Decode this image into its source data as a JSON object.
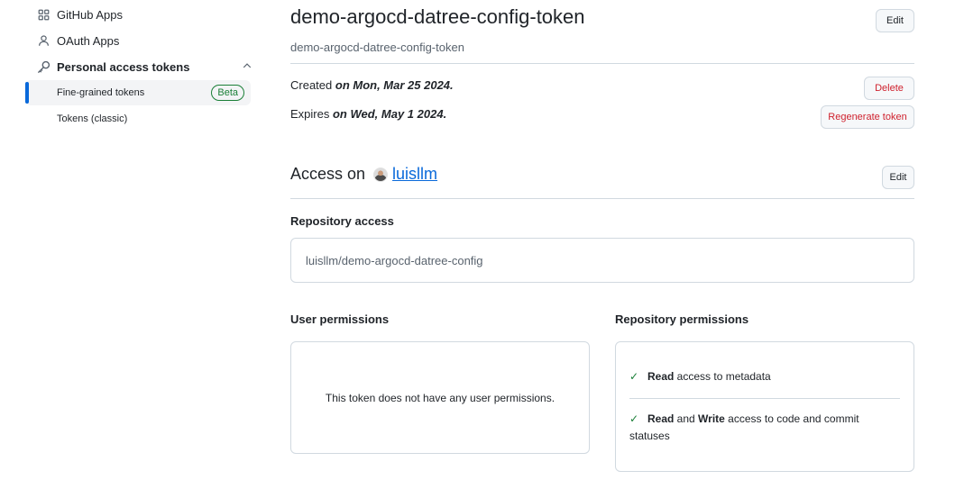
{
  "sidebar": {
    "github_apps": "GitHub Apps",
    "oauth_apps": "OAuth Apps",
    "personal_access_tokens": "Personal access tokens",
    "fine_grained": "Fine-grained tokens",
    "beta": "Beta",
    "classic": "Tokens (classic)"
  },
  "token": {
    "title": "demo-argocd-datree-config-token",
    "description": "demo-argocd-datree-config-token",
    "edit_label": "Edit",
    "created_prefix": "Created",
    "created_date": "on Mon, Mar 25 2024.",
    "expires_prefix": "Expires",
    "expires_date": "on Wed, May 1 2024.",
    "delete_label": "Delete",
    "regenerate_label": "Regenerate token"
  },
  "access": {
    "heading": "Access on",
    "user": "luisllm",
    "edit_label": "Edit",
    "repository_access_label": "Repository access",
    "repository": "luisllm/demo-argocd-datree-config",
    "user_permissions_label": "User permissions",
    "user_permissions_empty": "This token does not have any user permissions.",
    "repository_permissions_label": "Repository permissions",
    "permissions": [
      {
        "bold1": "Read",
        "text1": " access to metadata"
      },
      {
        "bold1": "Read",
        "mid": " and ",
        "bold2": "Write",
        "text2": " access to code and commit statuses"
      }
    ]
  },
  "colors": {
    "accent": "#0969da",
    "success": "#1a7f37",
    "danger": "#cf222e",
    "border": "#d1d9e0"
  },
  "icons": [
    "apps-grid-icon",
    "person-icon",
    "key-icon",
    "chevron-up-icon",
    "check-icon"
  ]
}
